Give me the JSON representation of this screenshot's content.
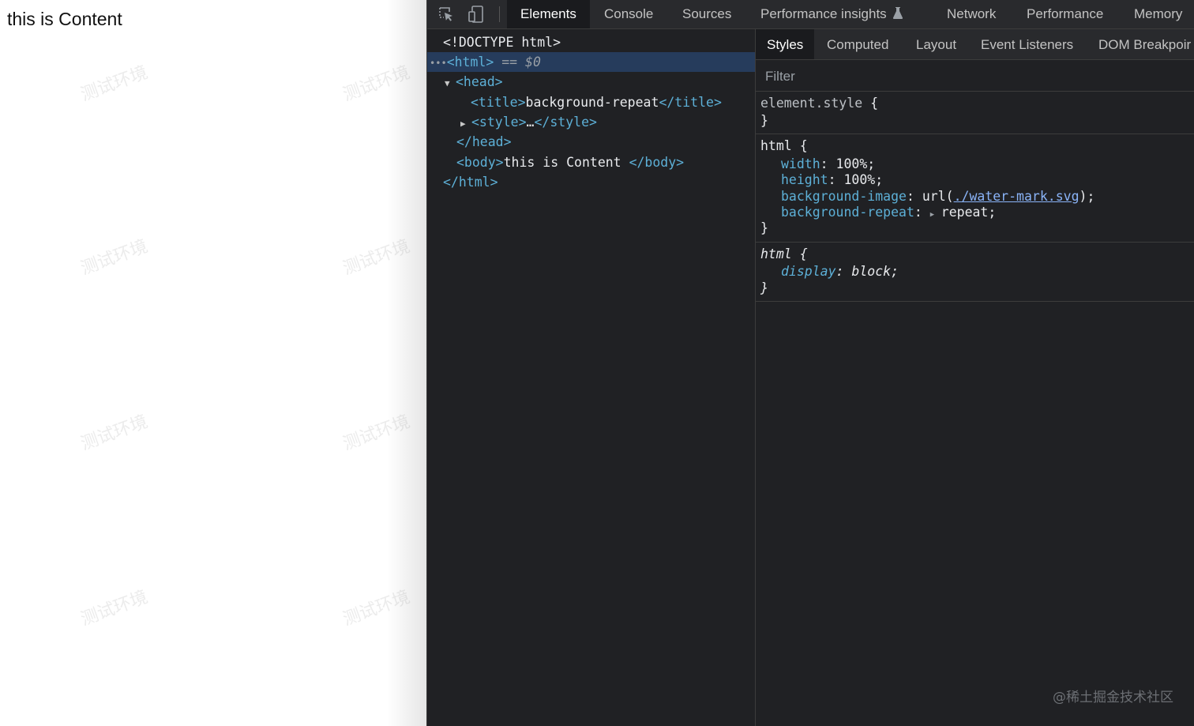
{
  "viewport": {
    "content_text": "this is Content",
    "watermark_text": "测试环境"
  },
  "devtools": {
    "toolbar": {
      "inspect_icon": "element-picker-icon",
      "device_icon": "device-toolbar-icon"
    },
    "tabs": [
      {
        "label": "Elements",
        "active": true
      },
      {
        "label": "Console"
      },
      {
        "label": "Sources"
      },
      {
        "label": "Performance insights"
      },
      {
        "label": "Network"
      },
      {
        "label": "Performance"
      },
      {
        "label": "Memory"
      }
    ],
    "dom_tree": {
      "doctype": "<!DOCTYPE html>",
      "html_open": "<html>",
      "selected_marker": "== $0",
      "head_open": "<head>",
      "title_open": "<title>",
      "title_text": "background-repeat",
      "title_close": "</title>",
      "style_open": "<style>",
      "style_ellipsis": "…",
      "style_close": "</style>",
      "head_close": "</head>",
      "body_open": "<body>",
      "body_text": "this is Content ",
      "body_close": "</body>",
      "html_close": "</html>"
    },
    "sub_tabs": [
      {
        "label": "Styles",
        "active": true
      },
      {
        "label": "Computed"
      },
      {
        "label": "Layout"
      },
      {
        "label": "Event Listeners"
      },
      {
        "label": "DOM Breakpoir"
      }
    ],
    "filter_placeholder": "Filter",
    "rules": {
      "element_style": {
        "selector": "element.style",
        "open": "{",
        "close": "}"
      },
      "html_rule": {
        "selector": "html",
        "open": "{",
        "close": "}",
        "width_prop": "width",
        "width_val": "100%;",
        "height_prop": "height",
        "height_val": "100%;",
        "bgimage_prop": "background-image",
        "bgimage_pre": "url(",
        "bgimage_link": "./water-mark.svg",
        "bgimage_post": ");",
        "bgrepeat_prop": "background-repeat",
        "bgrepeat_val": "repeat;"
      },
      "ua_rule": {
        "selector": "html",
        "open": "{",
        "close": "}",
        "display_prop": "display",
        "display_val": "block;"
      }
    }
  },
  "credit": "@稀土掘金技术社区"
}
